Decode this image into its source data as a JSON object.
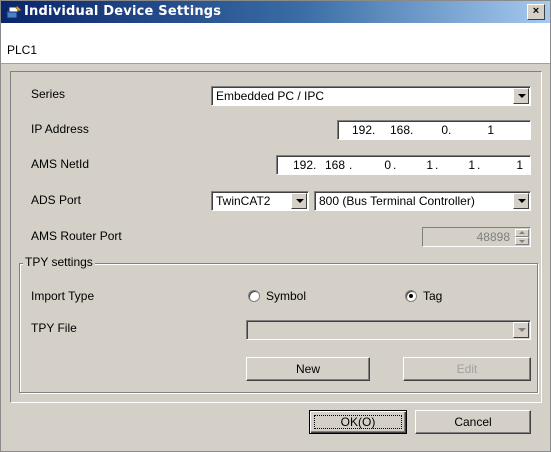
{
  "window": {
    "title": "Individual Device Settings",
    "close_label": "×"
  },
  "header": {
    "device_name": "PLC1"
  },
  "form": {
    "series": {
      "label": "Series",
      "value": "Embedded PC / IPC"
    },
    "ip_address": {
      "label": "IP Address",
      "octets": [
        "192",
        "168",
        "0",
        "1"
      ]
    },
    "ams_netid": {
      "label": "AMS NetId",
      "octets": [
        "192",
        "168",
        "0",
        "1",
        "1",
        "1"
      ]
    },
    "ads_port": {
      "label": "ADS Port",
      "type_value": "TwinCAT2",
      "port_value": "800 (Bus Terminal Controller)"
    },
    "ams_router_port": {
      "label": "AMS Router Port",
      "value": "48898"
    }
  },
  "tpy_settings": {
    "group_label": "TPY settings",
    "import_type_label": "Import Type",
    "options": [
      {
        "label": "Symbol",
        "selected": false
      },
      {
        "label": "Tag",
        "selected": true
      }
    ],
    "tpy_file_label": "TPY File",
    "tpy_file_value": "",
    "new_button": "New",
    "edit_button": "Edit"
  },
  "footer": {
    "ok_button": "OK(O)",
    "cancel_button": "Cancel"
  }
}
